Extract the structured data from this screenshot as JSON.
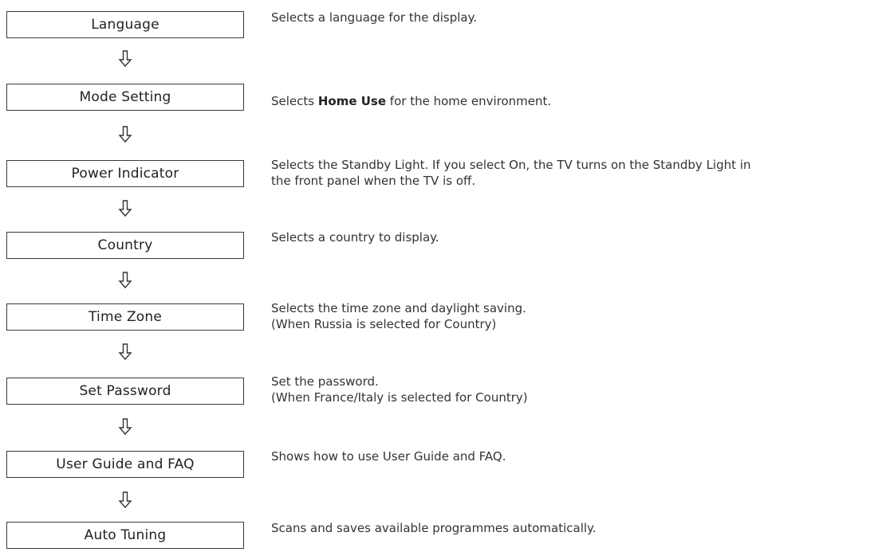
{
  "arrow_color": "#333333",
  "steps": [
    {
      "label": "Language",
      "description": "Selects a language for the display."
    },
    {
      "label": "Mode Setting",
      "description_pre": "Selects ",
      "description_bold": "Home Use",
      "description_post": " for the home environment."
    },
    {
      "label": "Power Indicator",
      "description_line1": "Selects the Standby Light. If you select On, the TV turns on the Standby Light in",
      "description_line2": "the front panel when the TV is off."
    },
    {
      "label": "Country",
      "description": "Selects a country to display."
    },
    {
      "label": "Time Zone",
      "description_line1": "Selects the time zone and daylight saving.",
      "description_line2": "(When Russia is selected for Country)"
    },
    {
      "label": "Set Password",
      "description_line1": "Set the password.",
      "description_line2": "(When France/Italy is selected for Country)"
    },
    {
      "label": "User Guide and FAQ",
      "description": "Shows how to use User Guide and FAQ."
    },
    {
      "label": "Auto Tuning",
      "description": "Scans and saves available programmes automatically."
    }
  ]
}
